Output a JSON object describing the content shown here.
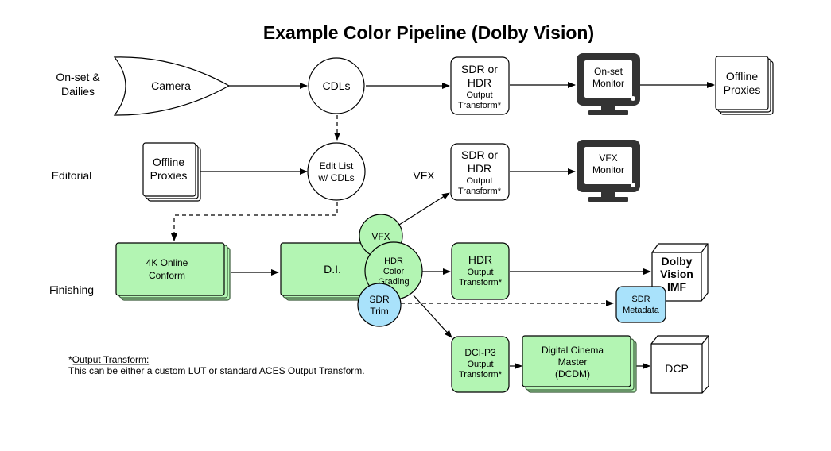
{
  "title": "Example Color Pipeline (Dolby Vision)",
  "lanes": {
    "onset_line1": "On-set &",
    "onset_line2": "Dailies",
    "editorial": "Editorial",
    "finishing": "Finishing",
    "vfx": "VFX"
  },
  "nodes": {
    "camera": "Camera",
    "cdls": "CDLs",
    "sdr_hdr_1": {
      "line1": "SDR or",
      "line2": "HDR",
      "line3": "Output",
      "line4": "Transform*"
    },
    "onset_monitor": {
      "line1": "On-set",
      "line2": "Monitor"
    },
    "offline_proxies_top": {
      "line1": "Offline",
      "line2": "Proxies"
    },
    "offline_proxies_editorial": {
      "line1": "Offline",
      "line2": "Proxies"
    },
    "edit_list": {
      "line1": "Edit List",
      "line2": "w/ CDLs"
    },
    "sdr_hdr_2": {
      "line1": "SDR or",
      "line2": "HDR",
      "line3": "Output",
      "line4": "Transform*"
    },
    "vfx_monitor": {
      "line1": "VFX",
      "line2": "Monitor"
    },
    "online_conform": {
      "line1": "4K Online",
      "line2": "Conform"
    },
    "di": "D.I.",
    "vfx_circle": "VFX",
    "hdr_grading": {
      "line1": "HDR",
      "line2": "Color",
      "line3": "Grading"
    },
    "sdr_trim": {
      "line1": "SDR",
      "line2": "Trim"
    },
    "hdr_output": {
      "line1": "HDR",
      "line2": "Output",
      "line3": "Transform*"
    },
    "dolby_imf": {
      "line1": "Dolby",
      "line2": "Vision",
      "line3": "IMF"
    },
    "sdr_metadata": {
      "line1": "SDR",
      "line2": "Metadata"
    },
    "dcip3_output": {
      "line1": "DCI-P3",
      "line2": "Output",
      "line3": "Transform*"
    },
    "dcdm": {
      "line1": "Digital Cinema",
      "line2": "Master",
      "line3": "(DCDM)"
    },
    "dcp": "DCP"
  },
  "footnote": {
    "asterisk": "*",
    "heading": "Output Transform:",
    "body": "This can be either a custom LUT or standard ACES Output Transform."
  },
  "colors": {
    "process_green": "#b3f5b3",
    "metadata_blue": "#a9e2fb",
    "monitor_dark": "#333333"
  }
}
